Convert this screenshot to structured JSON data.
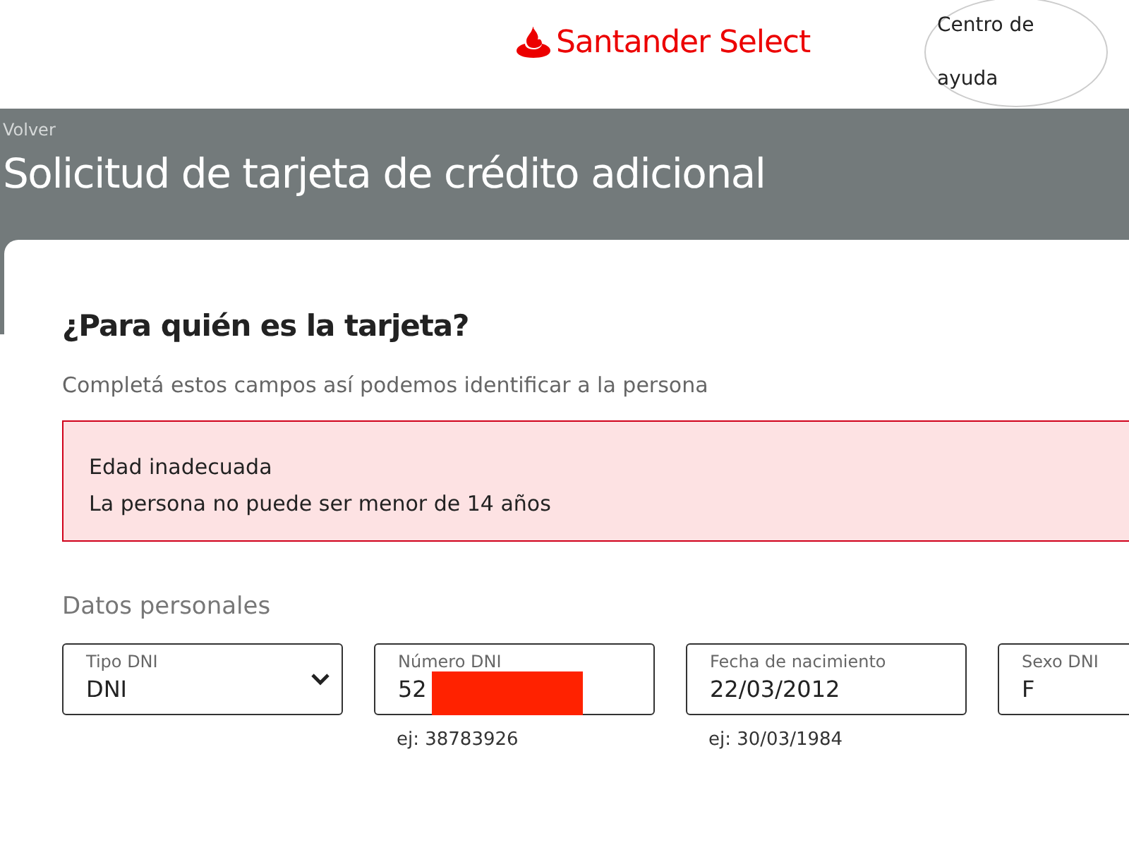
{
  "header": {
    "brand": "Santander Select",
    "help_button": "Centro de ayuda"
  },
  "banner": {
    "back_link": "Volver",
    "title": "Solicitud de tarjeta de crédito adicional"
  },
  "form": {
    "heading": "¿Para quién es la tarjeta?",
    "subtitle": "Completá estos campos así podemos identificar a la persona",
    "alert": {
      "title": "Edad inadecuada",
      "message": "La persona no puede ser menor de 14 años"
    },
    "section": "Datos personales",
    "fields": [
      {
        "kind": "select",
        "label": "Tipo DNI",
        "value": "DNI"
      },
      {
        "kind": "text",
        "label": "Número DNI",
        "value": "52",
        "hint": "ej: 38783926",
        "redacted": true
      },
      {
        "kind": "text",
        "label": "Fecha de nacimiento",
        "value": "22/03/2012",
        "hint": "ej: 30/03/1984"
      },
      {
        "kind": "text",
        "label": "Sexo DNI",
        "value": "F"
      }
    ]
  }
}
